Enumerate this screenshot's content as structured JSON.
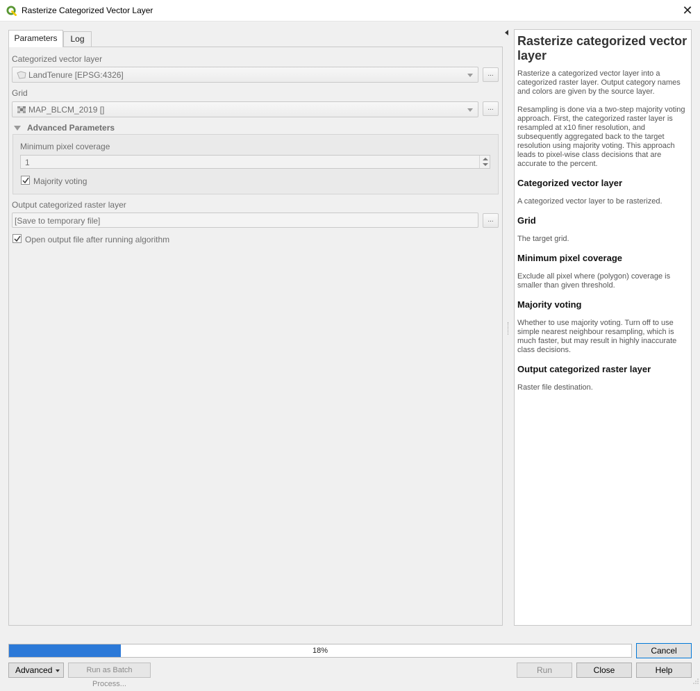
{
  "window": {
    "title": "Rasterize Categorized Vector Layer",
    "close_icon": "close-icon"
  },
  "tabs": [
    {
      "label": "Parameters",
      "active": true
    },
    {
      "label": "Log",
      "active": false
    }
  ],
  "params": {
    "vector_layer_label": "Categorized vector layer",
    "vector_layer_value": "LandTenure [EPSG:4326]",
    "vector_layer_icon": "polygon-layer-icon",
    "grid_label": "Grid",
    "grid_value": "MAP_BLCM_2019 []",
    "grid_icon": "raster-layer-icon",
    "browse_label": "...",
    "advanced_label": "Advanced Parameters",
    "min_coverage_label": "Minimum pixel coverage",
    "min_coverage_value": "1",
    "majority_label": "Majority voting",
    "majority_checked": true,
    "output_label": "Output categorized raster layer",
    "output_value": "[Save to temporary file]",
    "open_output_label": "Open output file after running algorithm",
    "open_output_checked": true
  },
  "help": {
    "title": "Rasterize categorized vector layer",
    "intro": "Rasterize a categorized vector layer into a categorized raster layer. Output category names and colors are given by the source layer.",
    "resampling": "Resampling is done via a two-step majority voting approach. First, the categorized raster layer is resampled at x10 finer resolution, and subsequently aggregated back to the target resolution using majority voting. This approach leads to pixel-wise class decisions that are accurate to the percent.",
    "sections": [
      {
        "heading": "Categorized vector layer",
        "text": "A categorized vector layer to be rasterized."
      },
      {
        "heading": "Grid",
        "text": "The target grid."
      },
      {
        "heading": "Minimum pixel coverage",
        "text": "Exclude all pixel where (polygon) coverage is smaller than given threshold."
      },
      {
        "heading": "Majority voting",
        "text": "Whether to use majority voting. Turn off to use simple nearest neighbour resampling, which is much faster, but may result in highly inaccurate class decisions."
      },
      {
        "heading": "Output categorized raster layer",
        "text": "Raster file destination."
      }
    ]
  },
  "progress": {
    "percent": 18,
    "label": "18%",
    "color": "#2b79d8"
  },
  "buttons": {
    "cancel": "Cancel",
    "advanced": "Advanced",
    "batch": "Run as Batch Process...",
    "run": "Run",
    "close": "Close",
    "help": "Help"
  },
  "colors": {
    "qgis_green": "#589632",
    "qgis_yellow": "#eec900",
    "default_button_border": "#0078d7"
  }
}
